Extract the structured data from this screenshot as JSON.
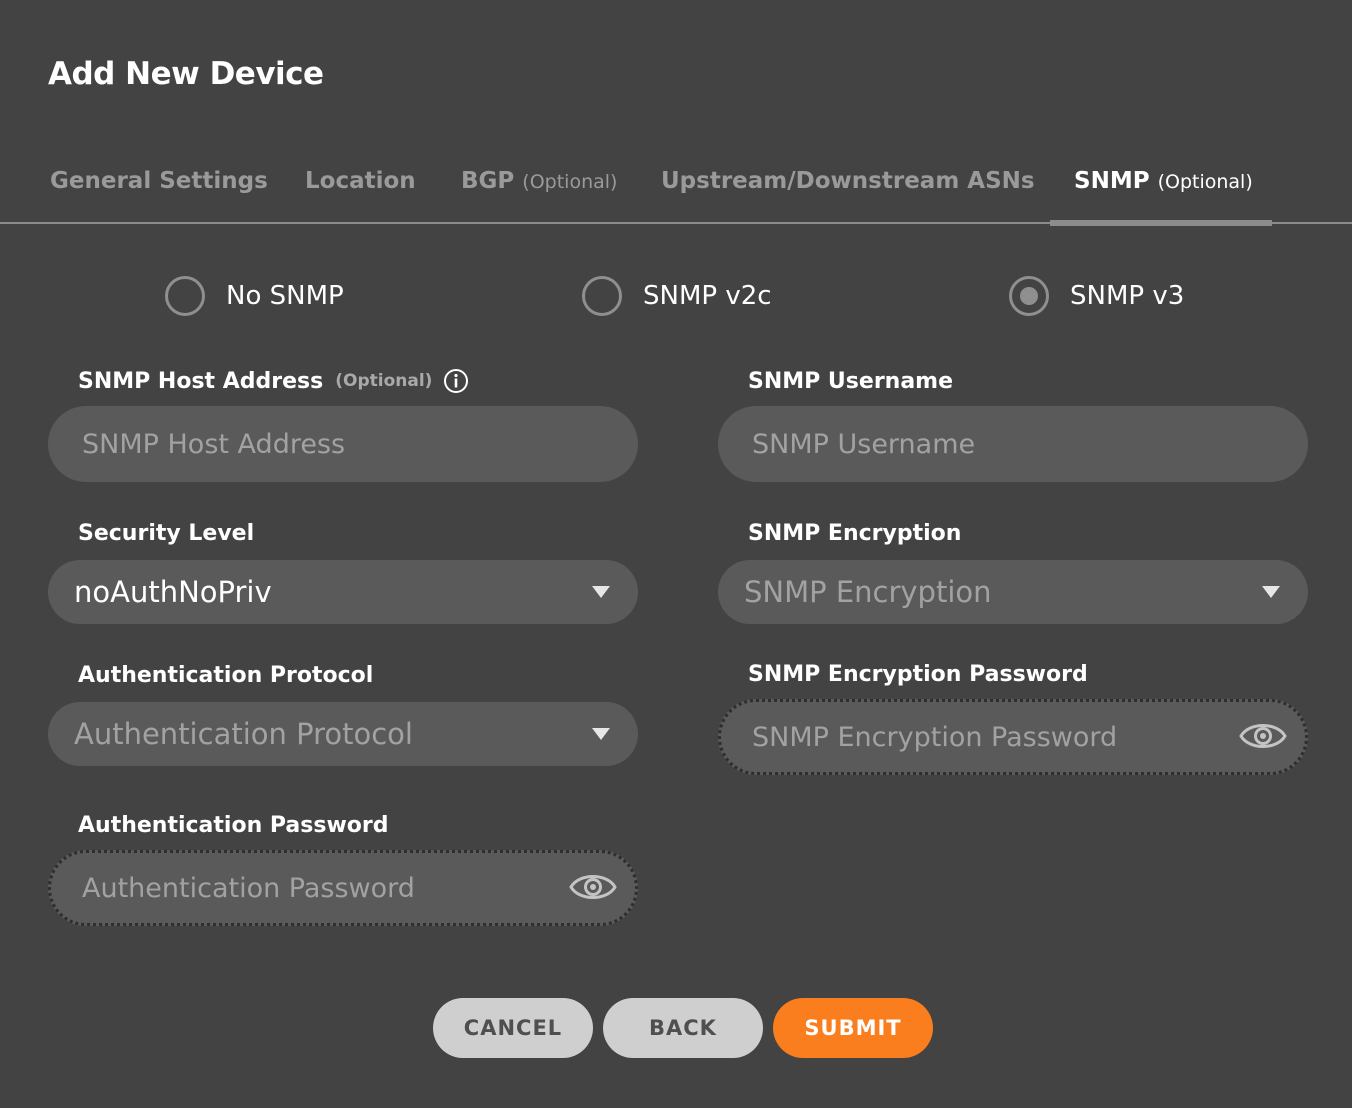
{
  "dialog": {
    "title": "Add New Device"
  },
  "tabs": [
    {
      "label": "General Settings",
      "optional": ""
    },
    {
      "label": "Location",
      "optional": ""
    },
    {
      "label": "BGP",
      "optional": "(Optional)"
    },
    {
      "label": "Upstream/Downstream ASNs",
      "optional": ""
    },
    {
      "label": "SNMP",
      "optional": "(Optional)",
      "active": true
    }
  ],
  "snmp_mode": {
    "options": [
      "No SNMP",
      "SNMP v2c",
      "SNMP v3"
    ],
    "selected": "SNMP v3"
  },
  "fields": {
    "host_address": {
      "label": "SNMP Host Address",
      "optional": "(Optional)",
      "placeholder": "SNMP Host Address",
      "value": ""
    },
    "username": {
      "label": "SNMP Username",
      "placeholder": "SNMP Username",
      "value": ""
    },
    "security_level": {
      "label": "Security Level",
      "value": "noAuthNoPriv"
    },
    "encryption": {
      "label": "SNMP Encryption",
      "placeholder": "SNMP Encryption"
    },
    "auth_protocol": {
      "label": "Authentication Protocol",
      "placeholder": "Authentication Protocol"
    },
    "encryption_password": {
      "label": "SNMP Encryption Password",
      "placeholder": "SNMP Encryption Password"
    },
    "auth_password": {
      "label": "Authentication Password",
      "placeholder": "Authentication Password"
    }
  },
  "buttons": {
    "cancel": "CANCEL",
    "back": "BACK",
    "submit": "SUBMIT"
  },
  "colors": {
    "background": "#434343",
    "field": "#5a5a5a",
    "accent": "#fa7d1e",
    "muted": "#9a9a9a"
  }
}
